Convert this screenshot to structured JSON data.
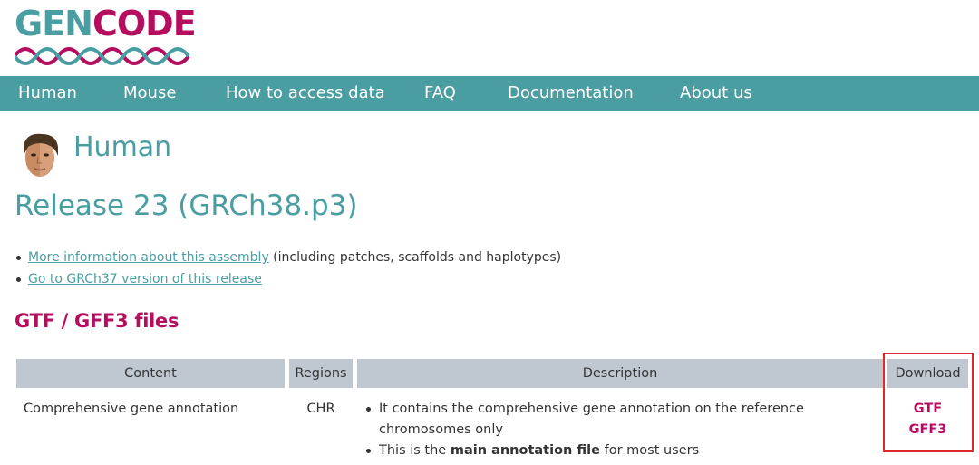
{
  "logo": {
    "part1": "GEN",
    "part2": "CODE"
  },
  "nav": {
    "items": [
      "Human",
      "Mouse",
      "How to access data",
      "FAQ",
      "Documentation",
      "About us"
    ]
  },
  "species": {
    "title": "Human"
  },
  "release": {
    "title": "Release 23 (GRCh38.p3)"
  },
  "links": {
    "assembly_link": "More information about this assembly",
    "assembly_suffix": " (including patches, scaffolds and haplotypes)",
    "grch37_link": "Go to GRCh37 version of this release"
  },
  "section": {
    "title": "GTF / GFF3 files"
  },
  "table": {
    "headers": [
      "Content",
      "Regions",
      "Description",
      "Download"
    ],
    "rows": [
      {
        "content": "Comprehensive gene annotation",
        "regions": "CHR",
        "desc1": "It contains the comprehensive gene annotation on the reference chromosomes only",
        "desc2_pre": "This is the ",
        "desc2_bold": "main annotation file",
        "desc2_post": " for most users",
        "downloads": [
          "GTF",
          "GFF3"
        ]
      }
    ]
  },
  "colors": {
    "teal": "#4a9ea1",
    "magenta": "#b50e5e",
    "header_gray": "#bfc8d0",
    "highlight_red": "#e0282b"
  },
  "icons": {
    "species": "human-face-icon",
    "logo": "double-helix-icon"
  }
}
